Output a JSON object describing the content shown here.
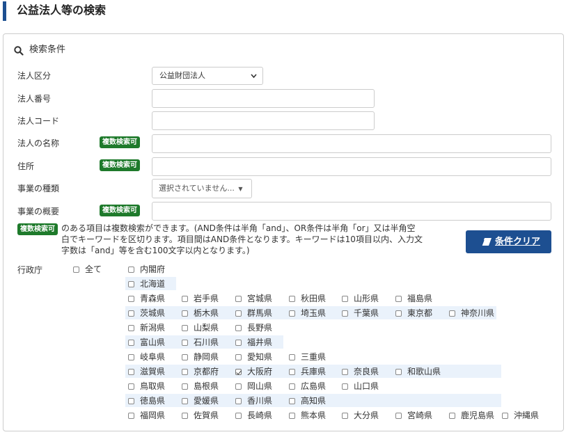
{
  "page_title": "公益法人等の検索",
  "panel_title": "検索条件",
  "fields": {
    "corp_type_label": "法人区分",
    "corp_type_value": "公益財団法人",
    "corp_number_label": "法人番号",
    "corp_code_label": "法人コード",
    "corp_name_label": "法人の名称",
    "address_label": "住所",
    "business_type_label": "事業の種類",
    "business_type_value": "選択されていません...",
    "business_summary_label": "事業の概要"
  },
  "badge_text": "複数検索可",
  "note_text": "のある項目は複数検索ができます。(AND条件は半角「and」、OR条件は半角「or」又は半角空白でキーワードを区切ります。項目間はAND条件となります。キーワードは10項目以内、入力文字数は「and」等を含む100文字以内となります。)",
  "clear_button": "条件クリア",
  "admin_label": "行政庁",
  "all_label": "全て",
  "prefectures": [
    {
      "name": "内閣府",
      "checked": false
    },
    {
      "name": "北海道",
      "checked": false
    },
    {
      "name": "青森県",
      "checked": false
    },
    {
      "name": "岩手県",
      "checked": false
    },
    {
      "name": "宮城県",
      "checked": false
    },
    {
      "name": "秋田県",
      "checked": false
    },
    {
      "name": "山形県",
      "checked": false
    },
    {
      "name": "福島県",
      "checked": false
    },
    {
      "name": "茨城県",
      "checked": false
    },
    {
      "name": "栃木県",
      "checked": false
    },
    {
      "name": "群馬県",
      "checked": false
    },
    {
      "name": "埼玉県",
      "checked": false
    },
    {
      "name": "千葉県",
      "checked": false
    },
    {
      "name": "東京都",
      "checked": false
    },
    {
      "name": "神奈川県",
      "checked": false
    },
    {
      "name": "新潟県",
      "checked": false
    },
    {
      "name": "山梨県",
      "checked": false
    },
    {
      "name": "長野県",
      "checked": false
    },
    {
      "name": "富山県",
      "checked": false
    },
    {
      "name": "石川県",
      "checked": false
    },
    {
      "name": "福井県",
      "checked": false
    },
    {
      "name": "岐阜県",
      "checked": false
    },
    {
      "name": "静岡県",
      "checked": false
    },
    {
      "name": "愛知県",
      "checked": false
    },
    {
      "name": "三重県",
      "checked": false
    },
    {
      "name": "滋賀県",
      "checked": false
    },
    {
      "name": "京都府",
      "checked": false
    },
    {
      "name": "大阪府",
      "checked": true
    },
    {
      "name": "兵庫県",
      "checked": false
    },
    {
      "name": "奈良県",
      "checked": false
    },
    {
      "name": "和歌山県",
      "checked": false
    },
    {
      "name": "鳥取県",
      "checked": false
    },
    {
      "name": "島根県",
      "checked": false
    },
    {
      "name": "岡山県",
      "checked": false
    },
    {
      "name": "広島県",
      "checked": false
    },
    {
      "name": "山口県",
      "checked": false
    },
    {
      "name": "徳島県",
      "checked": false
    },
    {
      "name": "愛媛県",
      "checked": false
    },
    {
      "name": "香川県",
      "checked": false
    },
    {
      "name": "高知県",
      "checked": false
    },
    {
      "name": "福岡県",
      "checked": false
    },
    {
      "name": "佐賀県",
      "checked": false
    },
    {
      "name": "長崎県",
      "checked": false
    },
    {
      "name": "熊本県",
      "checked": false
    },
    {
      "name": "大分県",
      "checked": false
    },
    {
      "name": "宮崎県",
      "checked": false
    },
    {
      "name": "鹿児島県",
      "checked": false
    },
    {
      "name": "沖縄県",
      "checked": false
    }
  ],
  "colors": {
    "accent": "#1d4f91",
    "badge": "#1e7a2b",
    "row_highlight": "#eaf2fb"
  }
}
